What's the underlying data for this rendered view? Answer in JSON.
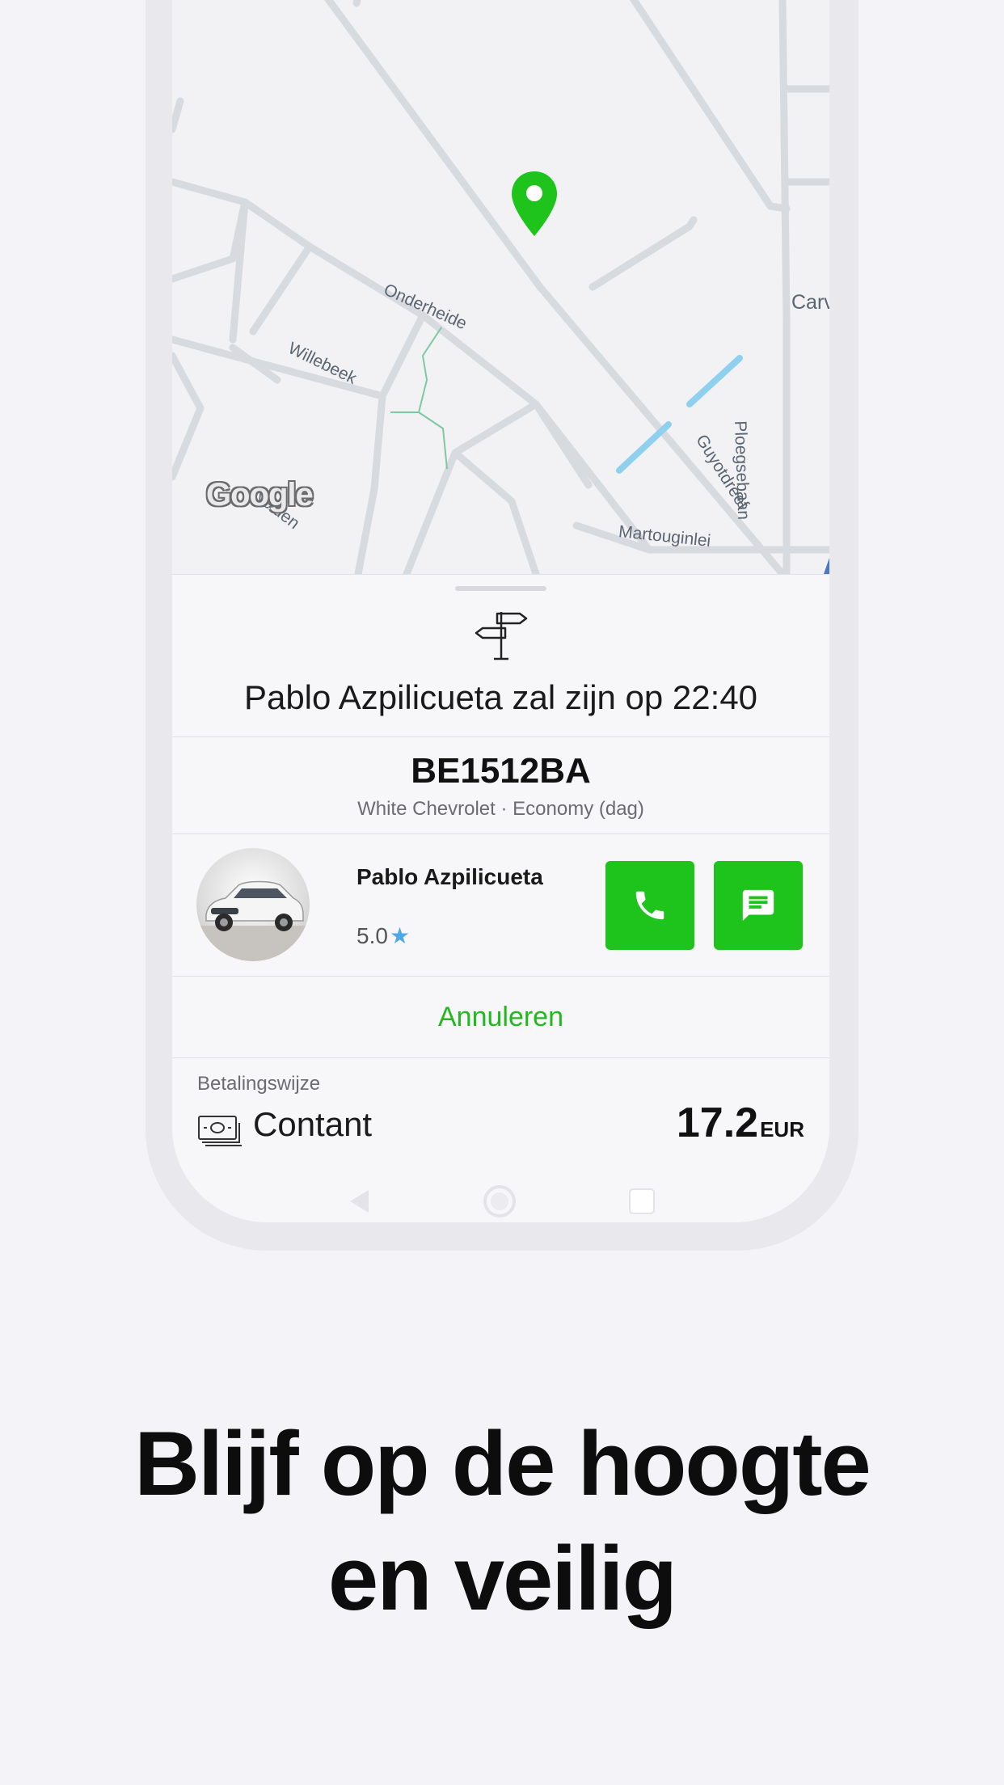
{
  "map": {
    "streets": [
      "Onderheide",
      "Willebeek",
      "Guyotdreef",
      "Ploegsebaan",
      "Martouginlei",
      "Nelden",
      "Carv"
    ],
    "logo": "Google",
    "pin_color": "#1ec31b"
  },
  "trip": {
    "icon": "signpost-icon",
    "arrival_text": "Pablo Azpilicueta zal zijn op 22:40",
    "plate": "BE1512BA",
    "car_description": "White Chevrolet · Economy (dag)"
  },
  "driver": {
    "name": "Pablo Azpilicueta",
    "rating": "5.0",
    "star": "★",
    "call_icon": "phone-icon",
    "message_icon": "message-icon"
  },
  "actions": {
    "cancel_label": "Annuleren"
  },
  "payment": {
    "label": "Betalingswijze",
    "method": "Contant",
    "method_icon": "cash-icon",
    "amount": "17.2",
    "currency": "EUR"
  },
  "colors": {
    "accent": "#1ec31b",
    "star": "#4fa8e6"
  },
  "headline": {
    "line1": "Blijf op de hoogte",
    "line2": "en veilig"
  }
}
